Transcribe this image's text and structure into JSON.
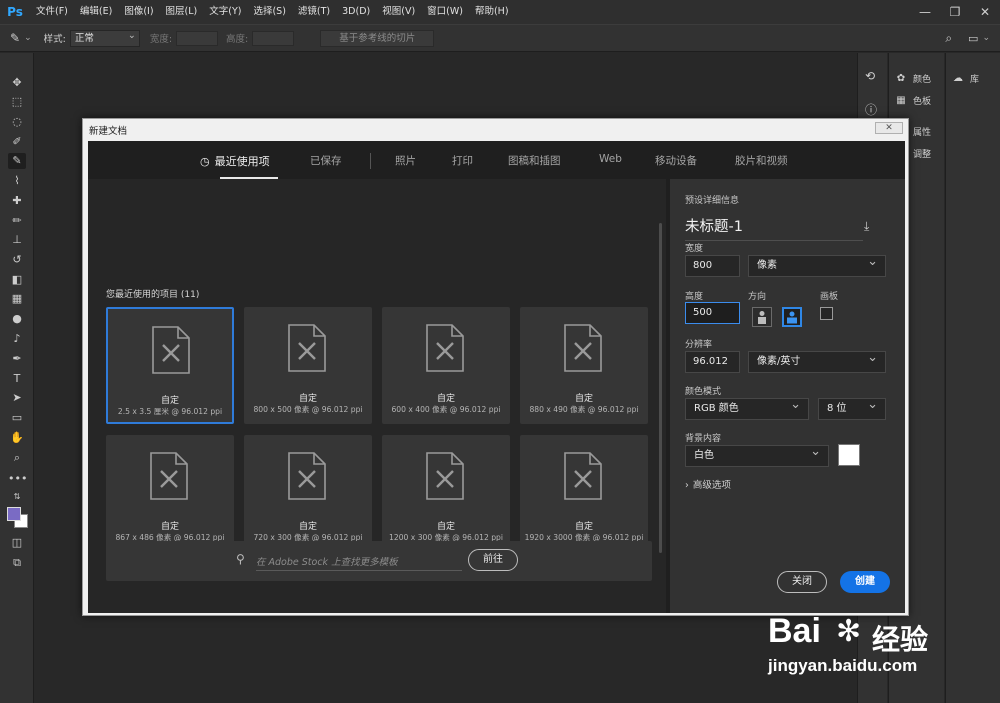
{
  "app": {
    "logo": "Ps"
  },
  "menu": [
    "文件(F)",
    "编辑(E)",
    "图像(I)",
    "图层(L)",
    "文字(Y)",
    "选择(S)",
    "滤镜(T)",
    "3D(D)",
    "视图(V)",
    "窗口(W)",
    "帮助(H)"
  ],
  "window_controls": {
    "minimize": "—",
    "restore": "❐",
    "close": "✕"
  },
  "options_bar": {
    "style_label": "样式:",
    "style_value": "正常",
    "width_label": "宽度:",
    "height_label": "高度:",
    "slice_button": "基于参考线的切片"
  },
  "right_dock": {
    "col2": [
      {
        "label": "颜色",
        "icon": "palette-icon"
      },
      {
        "label": "色板",
        "icon": "swatches-icon"
      },
      {
        "label": "属性",
        "icon": "properties-icon"
      },
      {
        "label": "调整",
        "icon": "adjust-icon"
      }
    ],
    "col3": [
      {
        "label": "库",
        "icon": "libraries-icon"
      }
    ]
  },
  "dialog": {
    "title": "新建文档",
    "close_label": "✕",
    "tabs": [
      "最近使用项",
      "已保存",
      "照片",
      "打印",
      "图稿和插图",
      "Web",
      "移动设备",
      "胶片和视频"
    ],
    "active_tab": 0,
    "recent_heading": "您最近使用的项目 (11)",
    "cards": [
      {
        "name": "自定",
        "size": "2.5 x 3.5 厘米 @ 96.012 ppi"
      },
      {
        "name": "自定",
        "size": "800 x 500 像素 @ 96.012 ppi"
      },
      {
        "name": "自定",
        "size": "600 x 400 像素 @ 96.012 ppi"
      },
      {
        "name": "自定",
        "size": "880 x 490 像素 @ 96.012 ppi"
      },
      {
        "name": "自定",
        "size": "867 x 486 像素 @ 96.012 ppi"
      },
      {
        "name": "自定",
        "size": "720 x 300 像素 @ 96.012 ppi"
      },
      {
        "name": "自定",
        "size": "1200 x 300 像素 @ 96.012 ppi"
      },
      {
        "name": "自定",
        "size": "1920 x 3000 像素 @ 96.012 ppi"
      }
    ],
    "stock_placeholder": "在 Adobe Stock 上查找更多模板",
    "stock_button": "前往",
    "preset": {
      "section_label": "预设详细信息",
      "name": "未标题-1",
      "width_label": "宽度",
      "width_value": "800",
      "width_unit": "像素",
      "height_label": "高度",
      "height_value": "500",
      "orientation_label": "方向",
      "artboard_label": "画板",
      "resolution_label": "分辨率",
      "resolution_value": "96.012",
      "resolution_unit": "像素/英寸",
      "color_mode_label": "颜色模式",
      "color_mode_value": "RGB 颜色",
      "bit_depth_value": "8 位",
      "background_label": "背景内容",
      "background_value": "白色",
      "background_color": "#ffffff",
      "advanced_label": "高级选项",
      "close_button": "关闭",
      "create_button": "创建"
    }
  },
  "watermark": {
    "brand": "Bai",
    "suffix": "经验",
    "url": "jingyan.baidu.com"
  },
  "colors": {
    "accent": "#1473e6",
    "selected_border": "#2f7bd9",
    "foreground_swatch": "#7a6bc4"
  }
}
